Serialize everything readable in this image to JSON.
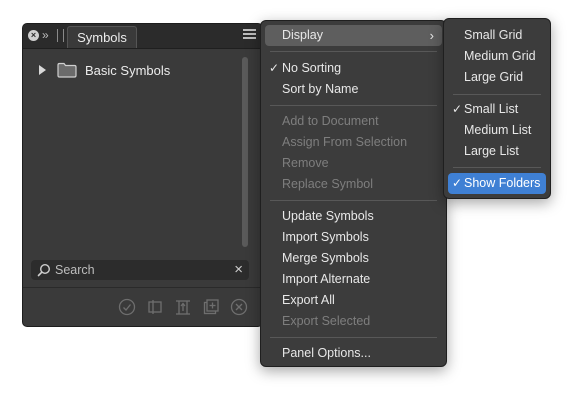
{
  "panel": {
    "tab_label": "Symbols",
    "tree": [
      {
        "label": "Basic Symbols",
        "expanded": false
      }
    ],
    "search": {
      "placeholder": "Search",
      "value": ""
    },
    "header_icons": [
      "close-icon",
      "collapse-icon",
      "panel-grip-icon",
      "panel-menu-icon"
    ],
    "footer_icons": [
      "checkmark-icon",
      "assign-icon",
      "replace-icon",
      "add-icon",
      "remove-icon"
    ]
  },
  "menu": {
    "items": [
      {
        "label": "Display",
        "submenu": true,
        "hover": true
      },
      {
        "label": "No Sorting",
        "checked": true
      },
      {
        "label": "Sort by Name"
      },
      {
        "label": "Add to Document",
        "disabled": true
      },
      {
        "label": "Assign From Selection",
        "disabled": true
      },
      {
        "label": "Remove",
        "disabled": true
      },
      {
        "label": "Replace Symbol",
        "disabled": true
      },
      {
        "label": "Update Symbols"
      },
      {
        "label": "Import Symbols"
      },
      {
        "label": "Merge Symbols"
      },
      {
        "label": "Import Alternate"
      },
      {
        "label": "Export All"
      },
      {
        "label": "Export Selected",
        "disabled": true
      },
      {
        "label": "Panel Options..."
      }
    ],
    "checkmark": "✓",
    "submenu_arrow": "›"
  },
  "submenu": {
    "items": [
      {
        "label": "Small Grid"
      },
      {
        "label": "Medium Grid"
      },
      {
        "label": "Large Grid"
      },
      {
        "label": "Small List",
        "checked": true
      },
      {
        "label": "Medium List"
      },
      {
        "label": "Large List"
      },
      {
        "label": "Show Folders",
        "checked": true,
        "selected": true
      }
    ]
  },
  "colors": {
    "panel_bg": "#3a3a3a",
    "menu_bg": "#3c3c3c",
    "highlight": "#3f80d4",
    "disabled_text": "#7e7e7e"
  }
}
